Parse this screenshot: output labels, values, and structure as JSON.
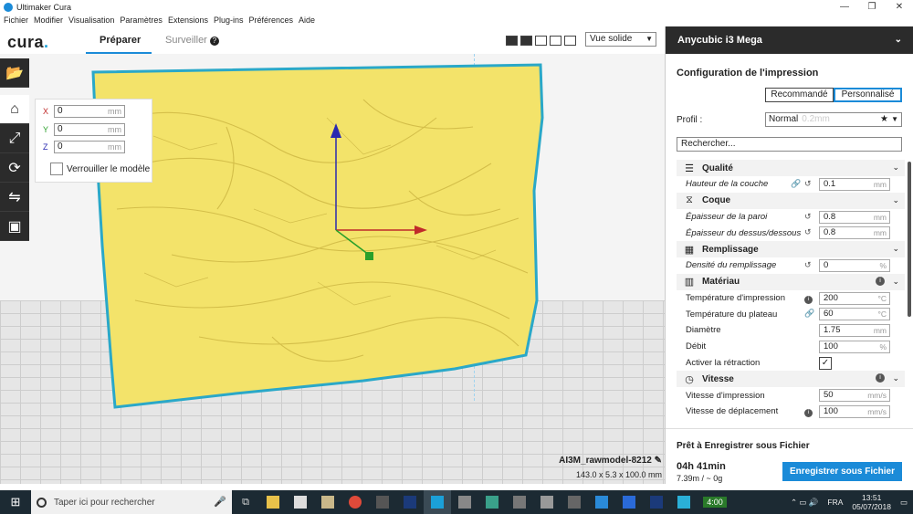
{
  "window": {
    "title": "Ultimaker Cura"
  },
  "menu": [
    "Fichier",
    "Modifier",
    "Visualisation",
    "Paramètres",
    "Extensions",
    "Plug-ins",
    "Préférences",
    "Aide"
  ],
  "header": {
    "logo_text": "cura",
    "logo_dot": ".",
    "tabs": {
      "prepare": "Préparer",
      "monitor": "Surveiller",
      "monitor_help": "?"
    },
    "view_mode": "Vue solide"
  },
  "move_panel": {
    "x": {
      "axis": "X",
      "value": "0",
      "unit": "mm"
    },
    "y": {
      "axis": "Y",
      "value": "0",
      "unit": "mm"
    },
    "z": {
      "axis": "Z",
      "value": "0",
      "unit": "mm"
    },
    "lock_label": "Verrouiller le modèle"
  },
  "model": {
    "name": "AI3M_rawmodel-8212",
    "dimensions": "143.0 x 5.3 x 100.0 mm"
  },
  "right_panel": {
    "printer": "Anycubic i3 Mega",
    "config_title": "Configuration de l'impression",
    "modes": {
      "recommended": "Recommandé",
      "custom": "Personnalisé"
    },
    "profile_label": "Profil :",
    "profile_value": "Normal",
    "profile_sub": "0.2mm",
    "search_placeholder": "Rechercher..."
  },
  "settings": {
    "quality": {
      "title": "Qualité",
      "layer_height": {
        "label": "Hauteur de la couche",
        "value": "0.1",
        "unit": "mm"
      }
    },
    "shell": {
      "title": "Coque",
      "wall_thickness": {
        "label": "Épaisseur de la paroi",
        "value": "0.8",
        "unit": "mm"
      },
      "top_bottom_thickness": {
        "label": "Épaisseur du dessus/dessous",
        "value": "0.8",
        "unit": "mm"
      }
    },
    "infill": {
      "title": "Remplissage",
      "density": {
        "label": "Densité du remplissage",
        "value": "0",
        "unit": "%"
      }
    },
    "material": {
      "title": "Matériau",
      "print_temp": {
        "label": "Température d'impression",
        "value": "200",
        "unit": "°C"
      },
      "bed_temp": {
        "label": "Température du plateau",
        "value": "60",
        "unit": "°C"
      },
      "diameter": {
        "label": "Diamètre",
        "value": "1.75",
        "unit": "mm"
      },
      "flow": {
        "label": "Débit",
        "value": "100",
        "unit": "%"
      },
      "retraction": {
        "label": "Activer la rétraction",
        "checked": "✓"
      }
    },
    "speed": {
      "title": "Vitesse",
      "print_speed": {
        "label": "Vitesse d'impression",
        "value": "50",
        "unit": "mm/s"
      },
      "travel_speed": {
        "label": "Vitesse de déplacement",
        "value": "100",
        "unit": "mm/s"
      }
    }
  },
  "save": {
    "title": "Prêt à Enregistrer sous Fichier",
    "time": "04h 41min",
    "material": "7.39m / ~ 0g",
    "button": "Enregistrer sous Fichier"
  },
  "taskbar": {
    "search_placeholder": "Taper ici pour rechercher",
    "timer": "4:00",
    "lang": "FRA",
    "time": "13:51",
    "date": "05/07/2018"
  },
  "colors": {
    "accent": "#1b8bd8",
    "model": "#f3e36a",
    "model_outline": "#2aa8c8"
  }
}
